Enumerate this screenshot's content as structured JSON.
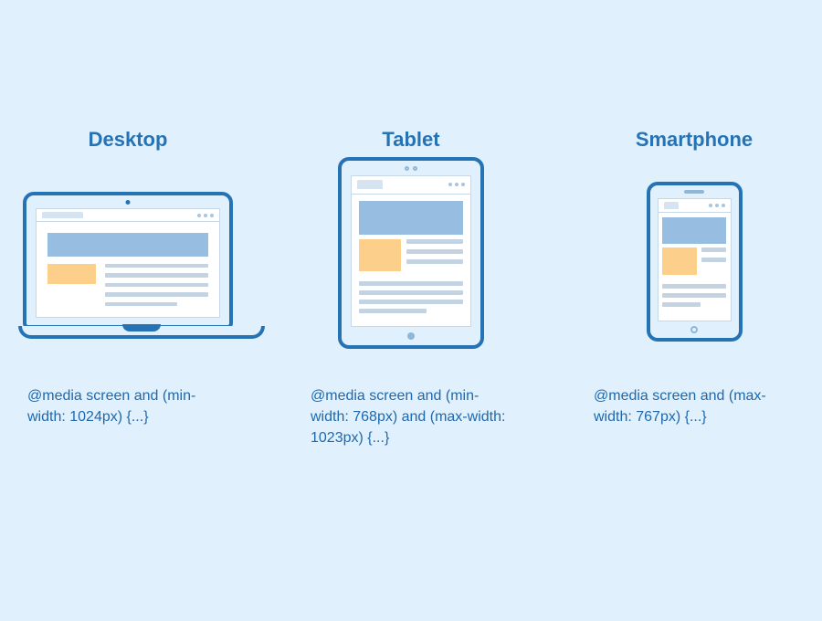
{
  "devices": [
    {
      "id": "desktop",
      "title": "Desktop",
      "media_query": "@media screen and (min-width: 1024px) {...}"
    },
    {
      "id": "tablet",
      "title": "Tablet",
      "media_query": "@media screen and (min-width: 768px) and (max-width: 1023px) {...}"
    },
    {
      "id": "smartphone",
      "title": "Smartphone",
      "media_query": "@media screen and (max-width: 767px) {...}"
    }
  ],
  "colors": {
    "background": "#e1f0fd",
    "stroke": "#2573b5",
    "text": "#1e69ad",
    "hero_block": "#97bde0",
    "thumb_block": "#fcd08a",
    "line": "#c4d3e1"
  }
}
